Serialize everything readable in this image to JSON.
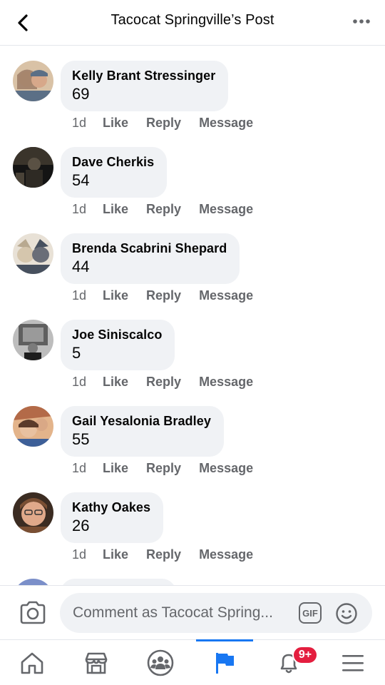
{
  "header": {
    "title": "Tacocat Springville’s Post",
    "back_icon": "chevron-left-icon",
    "more_icon": "more-horizontal-icon"
  },
  "comments": [
    {
      "name": "Kelly Brant Stressinger",
      "text": "69",
      "time": "1d",
      "avatar_colors": [
        "#9c7c66",
        "#d9c2a6",
        "#5b6f86"
      ]
    },
    {
      "name": "Dave Cherkis",
      "text": "54",
      "time": "1d",
      "avatar_colors": [
        "#2e2a24",
        "#5a5144",
        "#141414"
      ]
    },
    {
      "name": "Brenda Scabrini Shepard",
      "text": "44",
      "time": "1d",
      "avatar_colors": [
        "#b8a990",
        "#e8e1d6",
        "#47505e"
      ]
    },
    {
      "name": "Joe Siniscalco",
      "text": "5",
      "time": "1d",
      "avatar_colors": [
        "#5f5f5f",
        "#bdbdbd",
        "#1d1d1d"
      ]
    },
    {
      "name": "Gail Yesalonia Bradley",
      "text": "55",
      "time": "1d",
      "avatar_colors": [
        "#b36a48",
        "#e3b48b",
        "#3d5f98"
      ]
    },
    {
      "name": "Kathy Oakes",
      "text": "26",
      "time": "1d",
      "avatar_colors": [
        "#7a4f33",
        "#e0a98a",
        "#3b2c22"
      ]
    }
  ],
  "actions": {
    "like": "Like",
    "reply": "Reply",
    "message": "Message"
  },
  "composer": {
    "placeholder": "Comment as Tacocat Spring...",
    "gif_label": "GIF",
    "camera_icon": "camera-icon",
    "emoji_icon": "emoji-icon"
  },
  "tabbar": {
    "items": [
      {
        "icon": "home-icon"
      },
      {
        "icon": "marketplace-icon"
      },
      {
        "icon": "groups-icon"
      },
      {
        "icon": "flag-pages-icon",
        "active": true
      },
      {
        "icon": "bell-icon",
        "badge": "9+"
      },
      {
        "icon": "menu-icon"
      }
    ]
  },
  "colors": {
    "accent": "#1877f2",
    "badge": "#e41e3f",
    "bubble": "#f0f2f5",
    "secondary_text": "#65676b"
  }
}
